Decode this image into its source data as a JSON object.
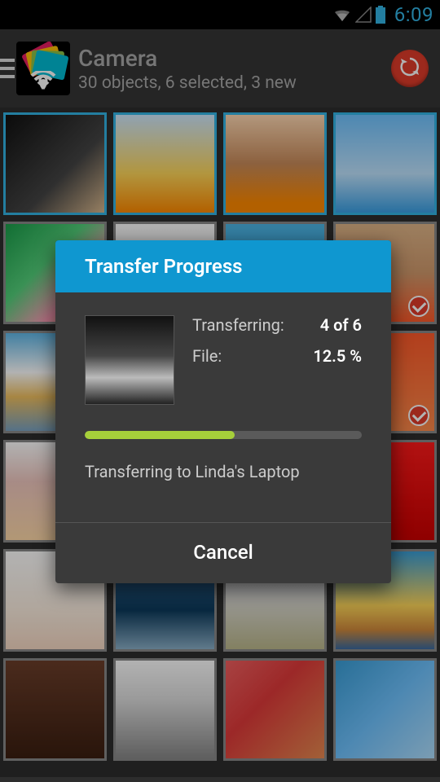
{
  "status": {
    "time": "6:09"
  },
  "app_bar": {
    "title": "Camera",
    "subtitle": "30 objects, 6 selected, 3 new"
  },
  "grid": {
    "items": [
      {
        "selected": true,
        "checked": false
      },
      {
        "selected": true,
        "checked": false
      },
      {
        "selected": true,
        "checked": false
      },
      {
        "selected": true,
        "checked": false
      },
      {
        "selected": false,
        "checked": false
      },
      {
        "selected": false,
        "checked": false
      },
      {
        "selected": false,
        "checked": false
      },
      {
        "selected": false,
        "checked": true
      },
      {
        "selected": false,
        "checked": false
      },
      {
        "selected": false,
        "checked": false
      },
      {
        "selected": false,
        "checked": false
      },
      {
        "selected": false,
        "checked": true
      },
      {
        "selected": false,
        "checked": false
      },
      {
        "selected": false,
        "checked": false
      },
      {
        "selected": false,
        "checked": false
      },
      {
        "selected": false,
        "checked": false
      },
      {
        "selected": false,
        "checked": false
      },
      {
        "selected": false,
        "checked": false
      },
      {
        "selected": false,
        "checked": false
      },
      {
        "selected": false,
        "checked": false
      },
      {
        "selected": false,
        "checked": false
      },
      {
        "selected": false,
        "checked": false
      },
      {
        "selected": false,
        "checked": false
      },
      {
        "selected": false,
        "checked": false
      }
    ]
  },
  "dialog": {
    "title": "Transfer Progress",
    "transferring_label": "Transferring:",
    "transferring_value": "4 of 6",
    "file_label": "File:",
    "file_value": "12.5 %",
    "progress_percent": 54,
    "destination_text": "Transferring to Linda's Laptop",
    "cancel_label": "Cancel"
  }
}
